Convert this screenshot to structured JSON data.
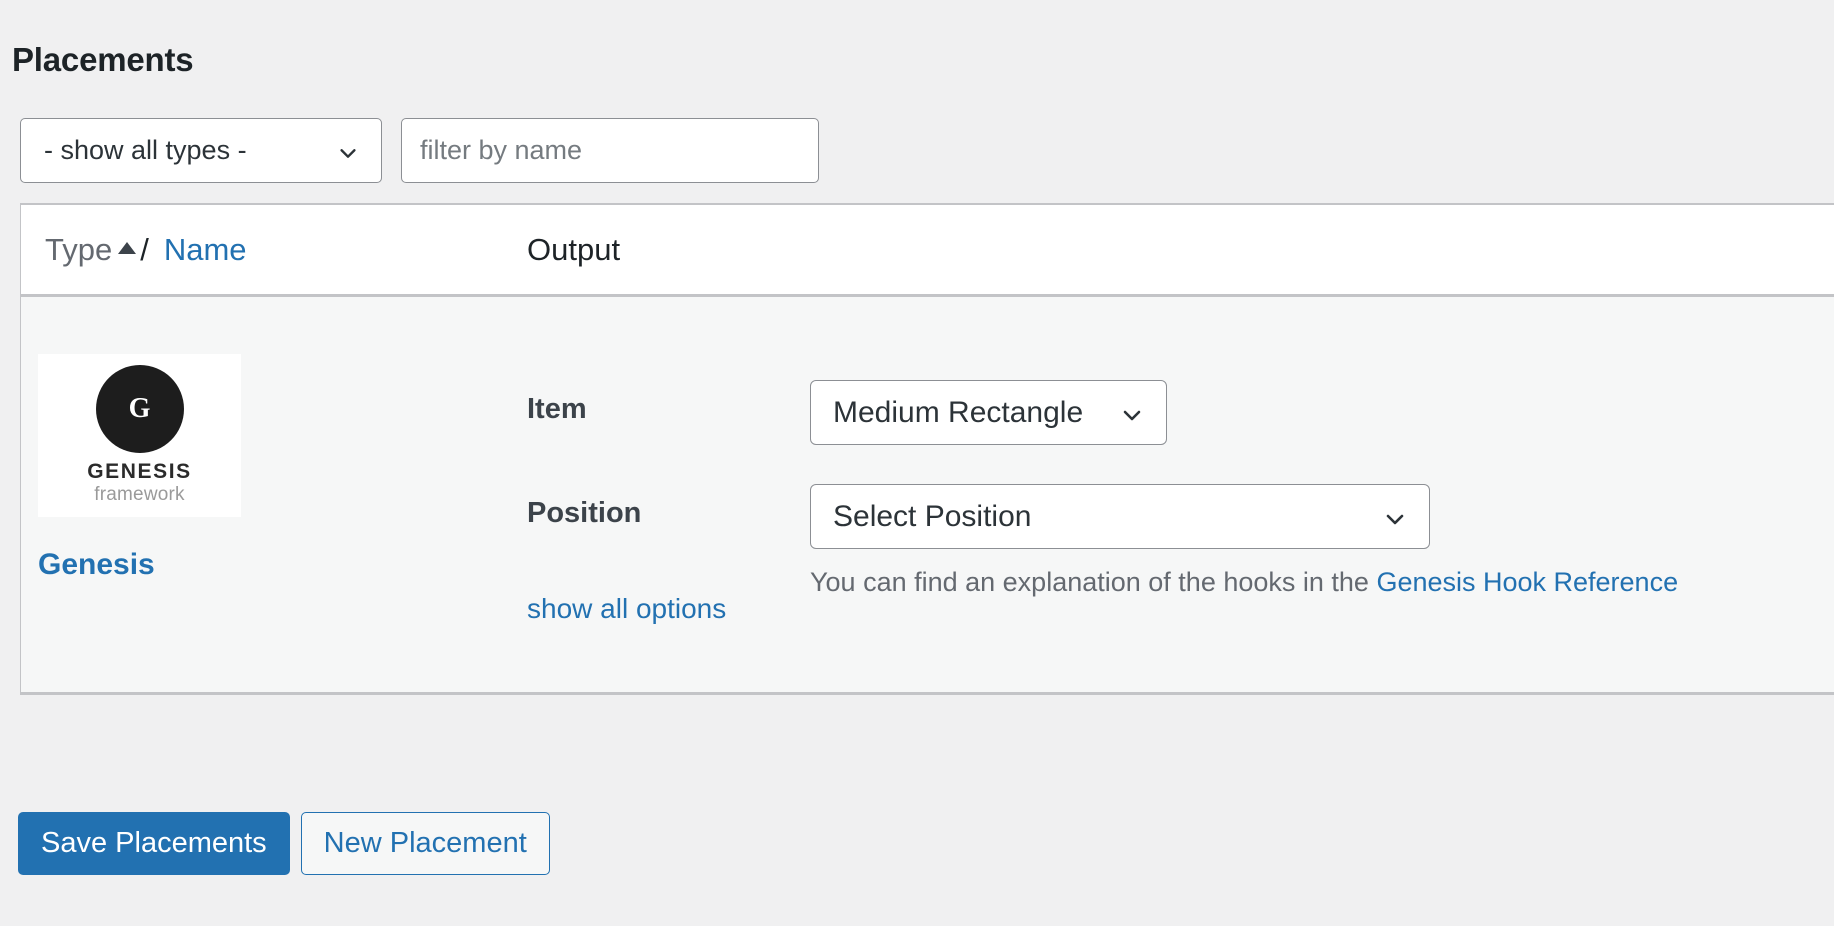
{
  "page": {
    "title": "Placements"
  },
  "filters": {
    "type_select": {
      "selected": "- show all types -",
      "icon": "chevron-down-icon"
    },
    "name_filter": {
      "value": "",
      "placeholder": "filter by name"
    }
  },
  "table": {
    "columns": {
      "type": "Type",
      "sort_indicator": "▲",
      "separator": "/",
      "name": "Name",
      "output": "Output"
    },
    "rows": [
      {
        "thumbnail": {
          "monogram": "G",
          "wordmark": "GENESIS",
          "subtitle": "framework"
        },
        "name": "Genesis",
        "fields": [
          {
            "label": "Item",
            "control": "select",
            "value": "Medium Rectangle",
            "icon": "chevron-down-icon"
          },
          {
            "label": "Position",
            "control": "select",
            "value": "Select Position",
            "icon": "chevron-down-icon",
            "help": {
              "prefix": "You can find an explanation of the hooks in the ",
              "link": "Genesis Hook Reference"
            }
          }
        ],
        "show_all_options": "show all options"
      }
    ]
  },
  "footer": {
    "save_label": "Save Placements",
    "new_label": "New Placement"
  },
  "colors": {
    "accent": "#2271b1",
    "page_bg": "#f0f0f1",
    "row_bg": "#f6f7f7",
    "border": "#c3c4c7",
    "text": "#1d2327",
    "muted": "#646970"
  }
}
